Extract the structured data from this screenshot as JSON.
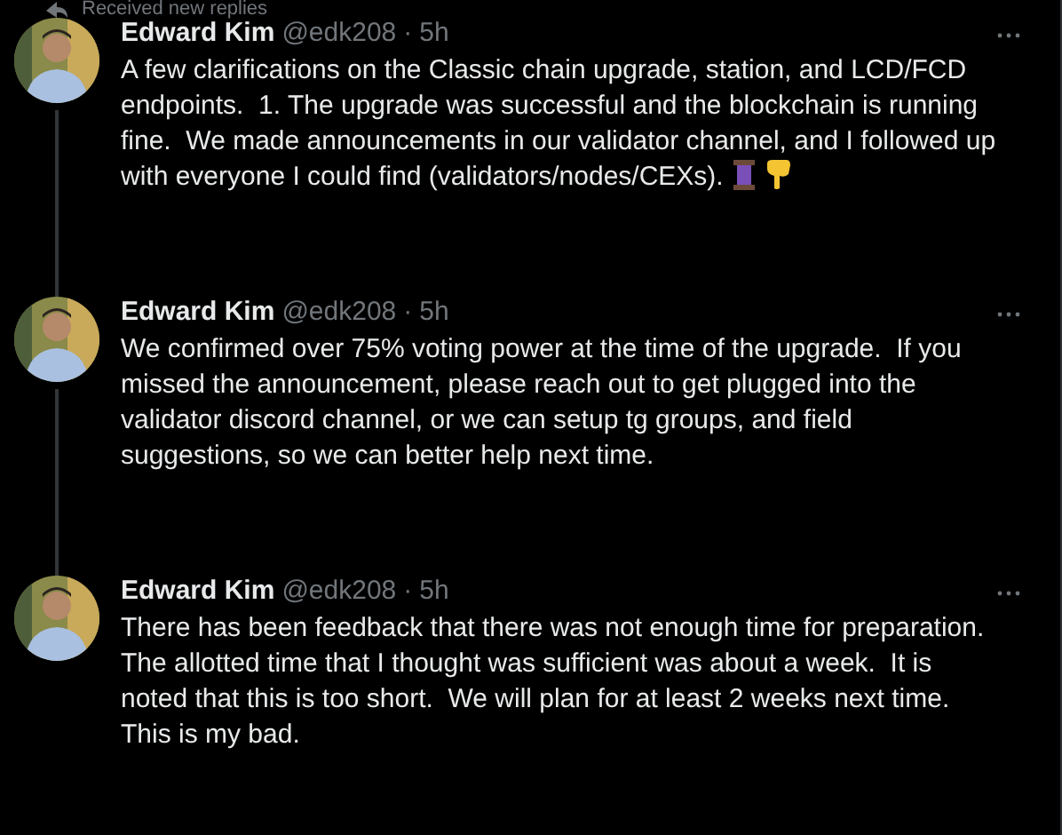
{
  "notice": {
    "text": "Received new replies"
  },
  "tweets": [
    {
      "name": "Edward Kim",
      "handle": "@edk208",
      "separator": "·",
      "time": "5h",
      "text": "A few clarifications on the Classic chain upgrade, station, and LCD/FCD endpoints.  1. The upgrade was successful and the blockchain is running fine.  We made announcements in our validator channel, and I followed up with everyone I could find (validators/nodes/CEXs).",
      "emojis": [
        {
          "kind": "spool"
        },
        {
          "kind": "pointing_down"
        }
      ]
    },
    {
      "name": "Edward Kim",
      "handle": "@edk208",
      "separator": "·",
      "time": "5h",
      "text": "We confirmed over 75% voting power at the time of the upgrade.  If you missed the announcement, please reach out to get plugged into the validator discord channel, or we can setup tg groups, and field suggestions, so we can better help next time."
    },
    {
      "name": "Edward Kim",
      "handle": "@edk208",
      "separator": "·",
      "time": "5h",
      "text": "There has been feedback that there was not enough time for preparation.  The allotted time that I thought was sufficient was about a week.  It is noted that this is too short.  We will plan for at least 2 weeks next time.  This is my bad."
    }
  ]
}
